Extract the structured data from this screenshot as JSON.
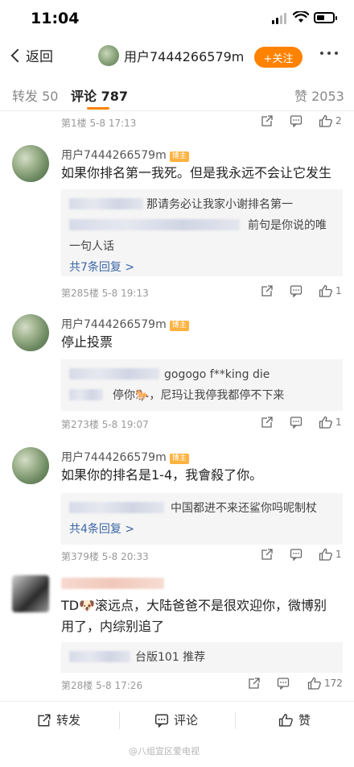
{
  "status_bar": {
    "time": "11:04"
  },
  "nav": {
    "back_label": "返回",
    "username": "用户7444266579m",
    "follow_label": "+关注"
  },
  "tabs": {
    "repost": "转发 50",
    "comment": "评论 787",
    "like": "赞 2053"
  },
  "top_meta": {
    "floor": "第1楼 5-8 17:13",
    "likes": "2"
  },
  "comments": [
    {
      "user": "用户7444266579m",
      "tag": "博主",
      "text": "如果你排名第一我死。但是我永远不会让它发生",
      "replies": [
        "那请务必让我家小谢排名第一",
        "前句是你说的唯",
        "一句人话"
      ],
      "more_replies": "共7条回复 >",
      "floor": "第285楼 5-8 19:13",
      "likes": "1"
    },
    {
      "user": "用户7444266579m",
      "tag": "博主",
      "text": "停止投票",
      "replies": [
        "gogogo f**king die",
        "停你🐎，尼玛让我停我都停不下来"
      ],
      "floor": "第273楼 5-8 19:07",
      "likes": "1"
    },
    {
      "user": "用户7444266579m",
      "tag": "博主",
      "text": "如果你的排名是1-4，我會殺了你。",
      "replies": [
        "中国都进不来还鲨你吗呢制杖"
      ],
      "more_replies": "共4条回复 >",
      "floor": "第379楼 5-8 20:33",
      "likes": "1"
    },
    {
      "text_line1": "TD🐶滚远点，大陆爸爸不是很欢迎你，微博别",
      "text_line2": "用了，内综别追了",
      "replies": [
        "台版101 推荐"
      ],
      "floor": "第28楼 5-8 17:26",
      "likes": "172"
    }
  ],
  "bottom_bar": {
    "repost": "转发",
    "comment": "评论",
    "like": "赞"
  },
  "watermark": "@八组宣区爱电视"
}
